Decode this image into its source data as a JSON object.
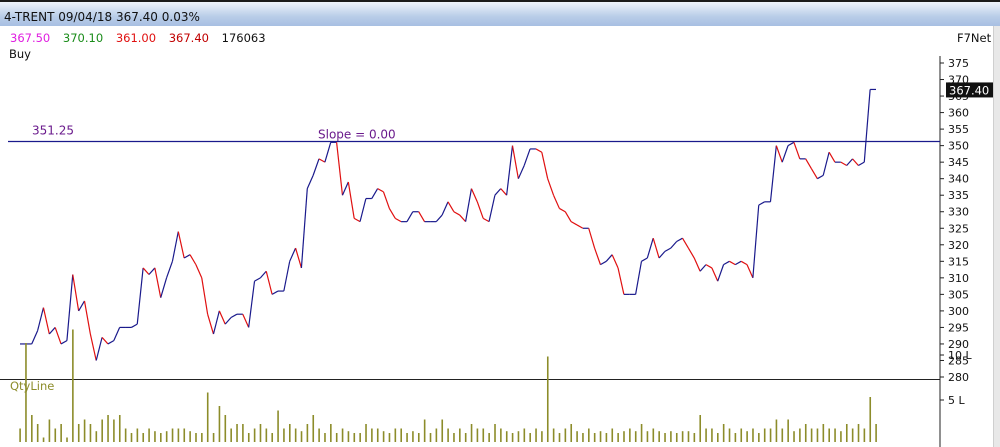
{
  "window": {
    "title": "4-TRENT  09/04/18 367.40 0.03%"
  },
  "ohlc": {
    "open": "367.50",
    "high": "370.10",
    "low": "361.00",
    "close": "367.40",
    "volume": "176063",
    "colors": {
      "open": "#e01ee0",
      "high": "#1a8c1a",
      "low": "#e01010",
      "close": "#c00000",
      "volume": "#111111"
    }
  },
  "signal": "Buy",
  "brand": "F7Net",
  "price_panel": {
    "last_label": "367.40",
    "hline_value": 351.25,
    "hline_label": "351.25",
    "slope_label": "Slope = 0.00",
    "colors": {
      "up": "#1a1a8c",
      "down": "#e01010",
      "hline": "#1a1a8c",
      "label": "#6a1a8c"
    }
  },
  "volume_panel": {
    "title": "QtyLine",
    "bar_color": "#8c8c2a"
  },
  "chart_data": [
    {
      "type": "line",
      "y_ticks": [
        280,
        285,
        290,
        295,
        300,
        305,
        310,
        315,
        320,
        325,
        330,
        335,
        340,
        345,
        350,
        355,
        360,
        365,
        370,
        375
      ],
      "ylim": [
        278,
        378
      ],
      "grid": false,
      "series": [
        {
          "values": [
            290,
            290,
            290,
            294,
            301,
            293,
            295,
            290,
            291,
            311,
            300,
            303,
            293,
            285,
            292,
            290,
            291,
            295,
            295,
            295,
            296,
            313,
            311,
            313,
            304,
            310,
            315,
            324,
            316,
            317,
            314,
            310,
            299,
            293,
            300,
            296,
            298,
            299,
            299,
            295,
            309,
            310,
            312,
            305,
            306,
            306,
            315,
            319,
            313,
            337,
            341,
            346,
            345,
            351,
            351,
            335,
            339,
            328,
            327,
            334,
            334,
            337,
            336,
            331,
            328,
            327,
            327,
            330,
            330,
            327,
            327,
            327,
            329,
            333,
            330,
            329,
            327,
            337,
            333,
            328,
            327,
            335,
            337,
            335,
            350,
            340,
            344,
            349,
            349,
            348,
            340,
            335,
            331,
            330,
            327,
            326,
            325,
            325,
            319,
            314,
            315,
            317,
            313,
            305,
            305,
            305,
            315,
            316,
            322,
            316,
            318,
            319,
            321,
            322,
            319,
            316,
            312,
            314,
            313,
            309,
            314,
            315,
            314,
            315,
            314,
            310,
            332,
            333,
            333,
            350,
            345,
            350,
            351,
            346,
            346,
            343,
            340,
            341,
            348,
            345,
            345,
            344,
            346,
            344,
            345,
            367,
            367
          ]
        }
      ]
    },
    {
      "type": "bar",
      "title": "QtyLine",
      "y_ticks": [
        "5 L",
        "10 L"
      ],
      "values": [
        1.5,
        11,
        3,
        2,
        0.5,
        2.5,
        1.5,
        2,
        0.5,
        12.5,
        2,
        2.5,
        2,
        1.2,
        2.5,
        3,
        2.5,
        3,
        1.5,
        1,
        1.5,
        1,
        1.5,
        1.2,
        1,
        1.2,
        1.5,
        1.5,
        1.5,
        1.2,
        1,
        1,
        5.5,
        1,
        4,
        3,
        1.5,
        2,
        2,
        1,
        1.5,
        2,
        1.5,
        1,
        3.5,
        1.5,
        2,
        1.5,
        1.2,
        2,
        3,
        1.5,
        1,
        2,
        1,
        1.5,
        1.2,
        1,
        1,
        2,
        1.5,
        1.5,
        1.2,
        1,
        1.5,
        1.5,
        1,
        1.2,
        1,
        2.5,
        1,
        1.5,
        2.5,
        1.5,
        1,
        1.5,
        1,
        2,
        1.5,
        1.5,
        1,
        2,
        1.5,
        1.2,
        1,
        1.2,
        1.5,
        1,
        1.5,
        1.2,
        9.5,
        1.5,
        1,
        1.5,
        2,
        1.2,
        1,
        1.5,
        1,
        1.2,
        1,
        1.5,
        1,
        1.2,
        1.5,
        1.2,
        2,
        1.2,
        1.5,
        1.2,
        1,
        1.2,
        1,
        1.2,
        1.2,
        1,
        3,
        1.5,
        1.5,
        1,
        2,
        1.5,
        1,
        1.5,
        1.2,
        1.5,
        1,
        1.5,
        1.5,
        2.5,
        1.5,
        2.5,
        1.2,
        1.5,
        2,
        1.5,
        1.5,
        2,
        1.5,
        1.5,
        1.2,
        2,
        1.5,
        2,
        1.5,
        5,
        2
      ]
    }
  ]
}
